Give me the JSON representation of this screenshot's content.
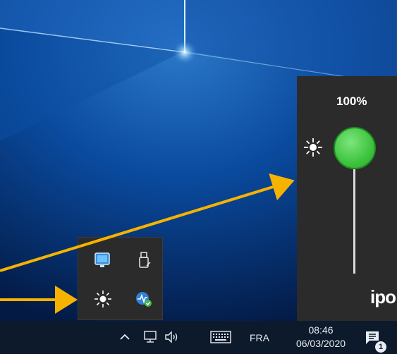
{
  "brightness": {
    "percent_label": "100%",
    "level": 1.0,
    "logo_text": "ipo"
  },
  "taskbar": {
    "language": "FRA",
    "time": "08:46",
    "date": "06/03/2020",
    "notification_count": "1"
  },
  "colors": {
    "arrow": "#f5b300",
    "slider_thumb": "#3ec43e",
    "panel_bg": "#2b2b2b",
    "taskbar_bg": "#0c1a2b"
  }
}
